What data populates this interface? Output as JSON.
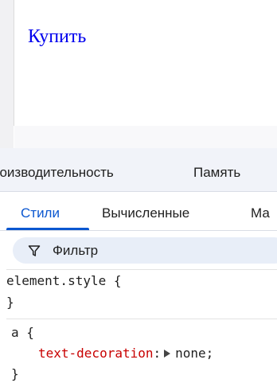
{
  "preview": {
    "link_text": "Купить"
  },
  "devtools": {
    "panel_tabs": [
      "роизводительность",
      "Память"
    ],
    "sub_tabs": [
      "Стили",
      "Вычисленные",
      "Ма"
    ],
    "active_sub_tab": "Стили",
    "filter": {
      "label": "Фильтр"
    },
    "rules": [
      {
        "selector": "element.style",
        "open": "{",
        "close": "}"
      },
      {
        "selector": "a",
        "open": "{",
        "close": "}",
        "property": {
          "name": "text-decoration",
          "colon": ":",
          "value": "none",
          "semicolon": ";"
        }
      }
    ]
  },
  "colors": {
    "link": "#0000ee",
    "accent": "#0b57d0",
    "property_name": "#c80000",
    "filter_bg": "#e8eef8",
    "panel_bg": "#f1f3f9"
  },
  "icons": [
    "filter-icon",
    "expand-triangle-icon"
  ]
}
